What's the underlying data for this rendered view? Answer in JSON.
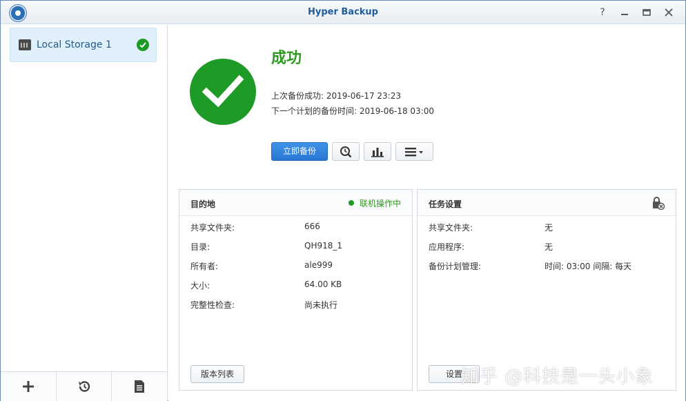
{
  "window": {
    "title": "Hyper Backup"
  },
  "sidebar": {
    "items": [
      {
        "label": "Local Storage 1",
        "status": "success"
      }
    ],
    "bottom_buttons": [
      "add-icon",
      "restore-icon",
      "log-icon"
    ]
  },
  "status": {
    "title": "成功",
    "last_backup": "上次备份成功: 2019-06-17 23:23",
    "next_backup": "下一个计划的备份时间: 2019-06-18 03:00"
  },
  "toolbar": {
    "backup_now_label": "立即备份"
  },
  "destination": {
    "title": "目的地",
    "status": "联机操作中",
    "rows": [
      {
        "key": "共享文件夹:",
        "value": "666"
      },
      {
        "key": "目录:",
        "value": "QH918_1"
      },
      {
        "key": "所有者:",
        "value": "ale999"
      },
      {
        "key": "大小:",
        "value": "64.00 KB"
      },
      {
        "key": "完整性检查:",
        "value": "尚未执行"
      }
    ],
    "button_label": "版本列表"
  },
  "task": {
    "title": "任务设置",
    "rows": [
      {
        "key": "共享文件夹:",
        "value": "无"
      },
      {
        "key": "应用程序:",
        "value": "无"
      },
      {
        "key": "备份计划管理:",
        "value": "时间: 03:00 间隔: 每天"
      }
    ],
    "button_label": "设置"
  },
  "watermark": "知乎 @科技是一头小象",
  "colors": {
    "success": "#1e9a26",
    "primary": "#2877d3",
    "title": "#1f5d9e"
  }
}
